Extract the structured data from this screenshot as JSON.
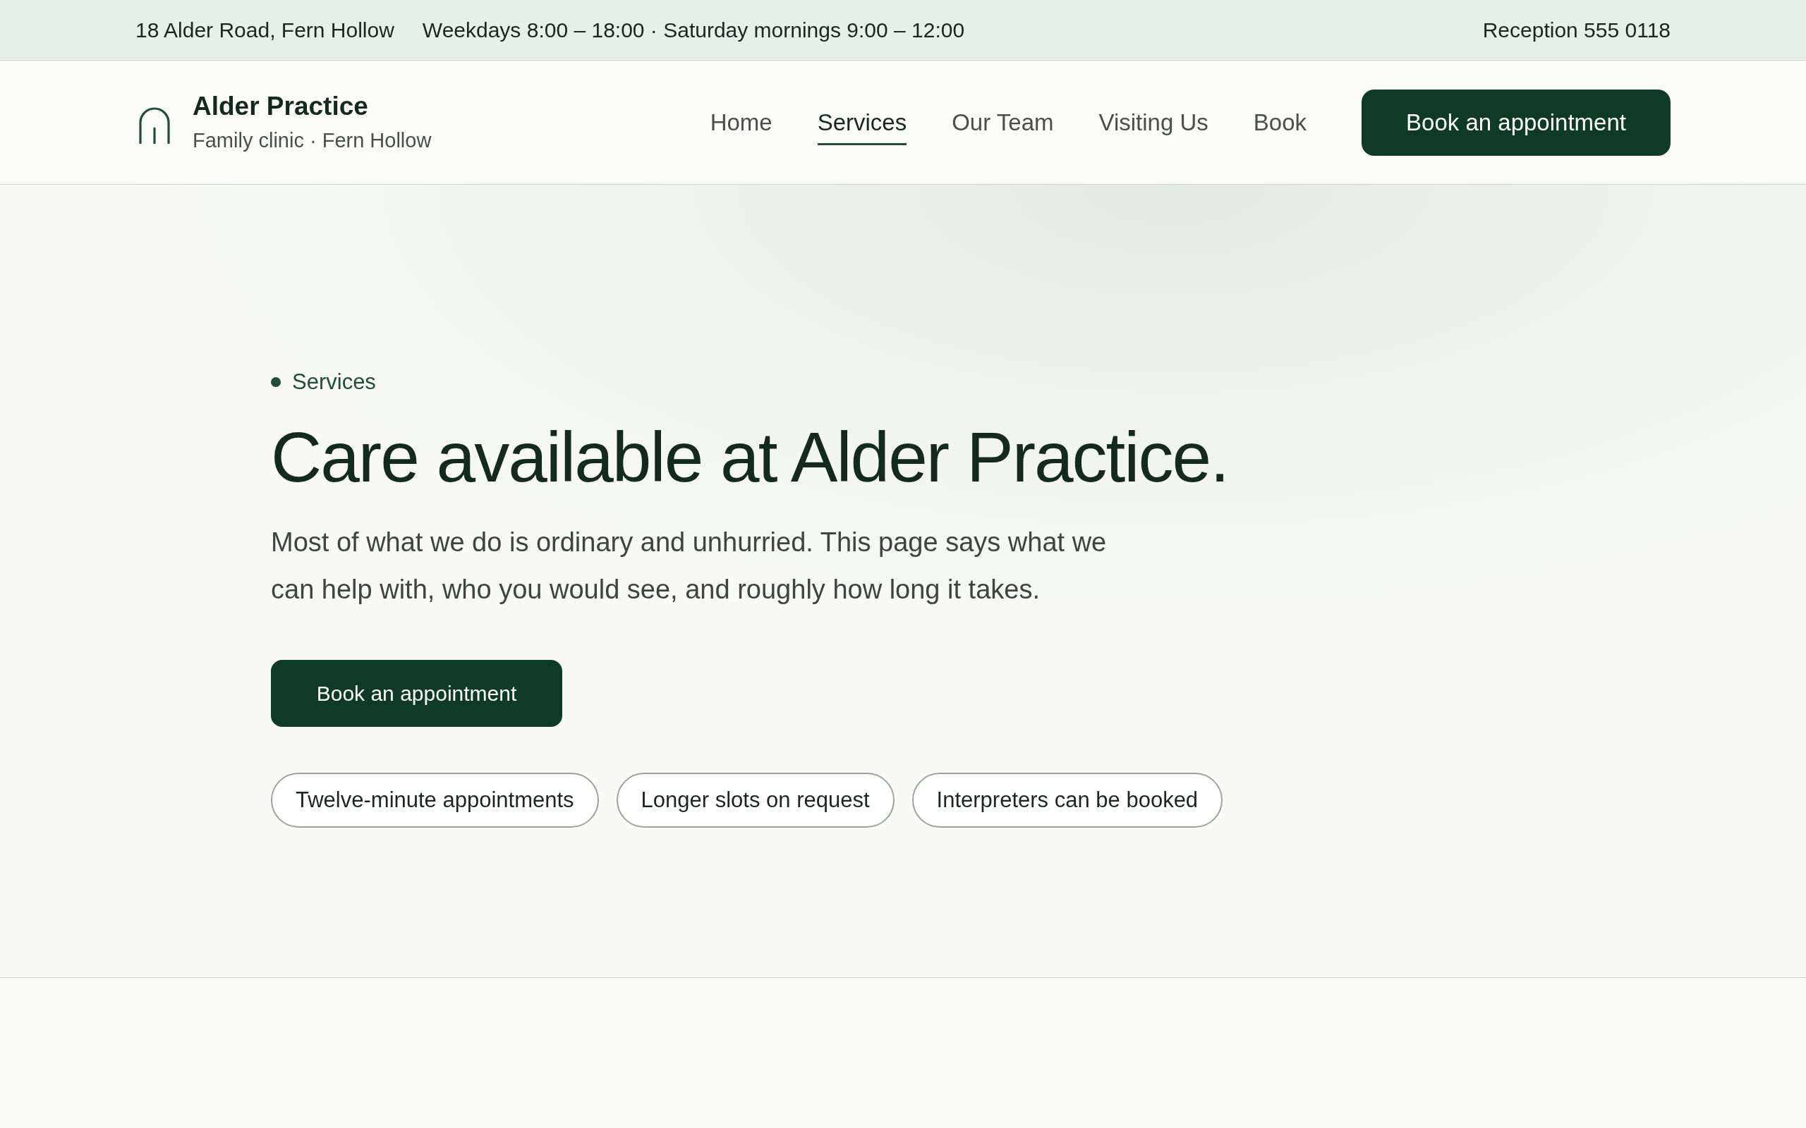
{
  "top_bar": {
    "address": "18 Alder Road, Fern Hollow",
    "hours": "Weekdays 8:00 – 18:00 · Saturday mornings 9:00 – 12:00",
    "phone": "Reception 555 0118"
  },
  "header": {
    "logo": {
      "name": "Alder Practice",
      "tagline": "Family clinic · Fern Hollow"
    },
    "nav": [
      {
        "label": "Home",
        "selected": false
      },
      {
        "label": "Services",
        "selected": true
      },
      {
        "label": "Our Team",
        "selected": false
      },
      {
        "label": "Visiting Us",
        "selected": false
      },
      {
        "label": "Book",
        "selected": false
      }
    ],
    "cta": "Book an appointment"
  },
  "hero": {
    "eyebrow": "Services",
    "title": "Care available at Alder Practice.",
    "lead": "Most of what we do is ordinary and unhurried. This page says what we can help with, who you would see, and roughly how long it takes.",
    "button": "Book an appointment",
    "chips": [
      "Twelve-minute appointments",
      "Longer slots on request",
      "Interpreters can be booked"
    ]
  }
}
